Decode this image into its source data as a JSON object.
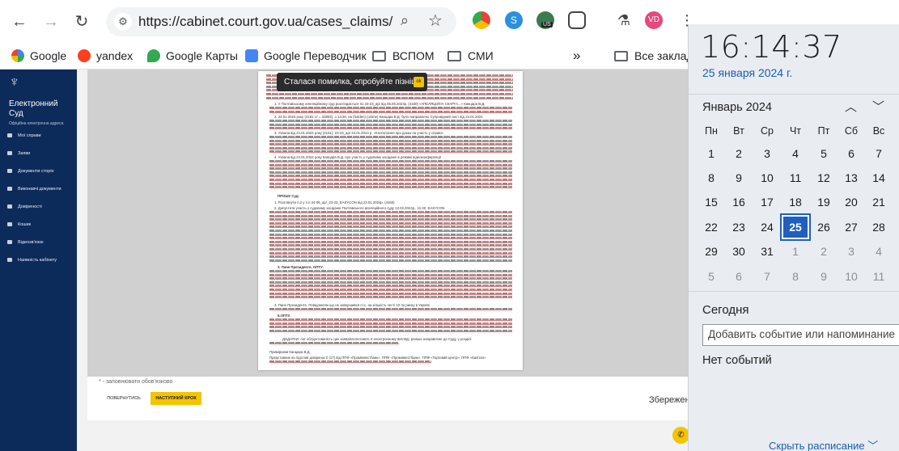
{
  "browser": {
    "url": "https://cabinet.court.gov.ua/cases_claims/0fc...",
    "profile_initials": "VD",
    "extension_badge": "US",
    "bookmarks": [
      "Google",
      "yandex",
      "Google Карты",
      "Google Переводчик",
      "ВСПОМ",
      "СМИ"
    ],
    "all_bookmarks": "Все закладки",
    "overflow": "»"
  },
  "sidebar": {
    "brand": "Електронний Суд",
    "brand_sub": "Офіційна електронна адреса",
    "items": [
      "Мої справи",
      "Заяви",
      "Документи сторін",
      "Виконавчі документи",
      "Довіреності",
      "Кошик",
      "Відеозв'язок",
      "Наявність кабінету"
    ]
  },
  "toast": {
    "text": "Сталася помилка, спробуйте пізніше.",
    "ok": "ok"
  },
  "document": {
    "lines": [
      "1. У Полтавському апеляційному суді розглядається по 23-23_ар/ від 06.09.2023р. (4160) «АПЕЛЯЦІЙНА СКАРГА...» Канцара В.Д.",
      "2. 24.01.2024 року (4181 ст = 33803), о 14:26, на (holden) (online) Канцара В.Д. було направлено Супровідний лист від 24.01.2024",
      "3. Ухвала від 24.01.2024 року (4161), 23-23_ар/ 23.01.2024 р. «Клопотання про доказ на участь у справі»",
      "4. Ухвала від 24.01.2024 року Канцара В.Д. про участь у судовому засіданні в режимі відеоконференції",
      "ПРОШУ Суд:",
      "1. Розглянути п.2 у п.п 24-05_ар/_23-23_EASYCON від 23.01.2024р. (4160)",
      "2. Допустити участь у судовому засіданні Полтавського апеляційного суду 12.02.2024р., 11:20, EASYCON",
      "3. Пане Президенте, OПТУ:",
      "4. Пане Президенте. Повідомляю що не завершився ст.с. на кількість честі 10 по ринку в Україні",
      "5.ОПТУ.",
      "ДОДАТКИ: лог обґрунтованість цих заява/клопотання, в електронному вигляді, раніше направлене до Суду, у розділі",
      "Примірники Канцара В.Д.",
      "Представник на підставі довіреності (17) від ППФ «Промінвестбанк», ППФ «Промінвестбанк», ППФ «Торговий центр», ППФ «Капітал»"
    ]
  },
  "form": {
    "required_note": "* - заповнювати обов'язково",
    "back_button": "ПОВЕРНУТИСЬ",
    "next_button": "НАСТУПНИЙ КРОК",
    "saving": "Збереження..."
  },
  "calendar": {
    "time": "16:14:37",
    "date": "25 января 2024 г.",
    "month": "Январь 2024",
    "weekdays": [
      "Пн",
      "Вт",
      "Ср",
      "Чт",
      "Пт",
      "Сб",
      "Вс"
    ],
    "weeks": [
      [
        "1",
        "2",
        "3",
        "4",
        "5",
        "6",
        "7"
      ],
      [
        "8",
        "9",
        "10",
        "11",
        "12",
        "13",
        "14"
      ],
      [
        "15",
        "16",
        "17",
        "18",
        "19",
        "20",
        "21"
      ],
      [
        "22",
        "23",
        "24",
        "25",
        "26",
        "27",
        "28"
      ],
      [
        "29",
        "30",
        "31",
        "1",
        "2",
        "3",
        "4"
      ],
      [
        "5",
        "6",
        "7",
        "8",
        "9",
        "10",
        "11"
      ]
    ],
    "today_label": "Сегодня",
    "event_placeholder": "Добавить событие или напоминание",
    "no_events": "Нет событий",
    "hide_schedule": "Скрыть расписание"
  }
}
